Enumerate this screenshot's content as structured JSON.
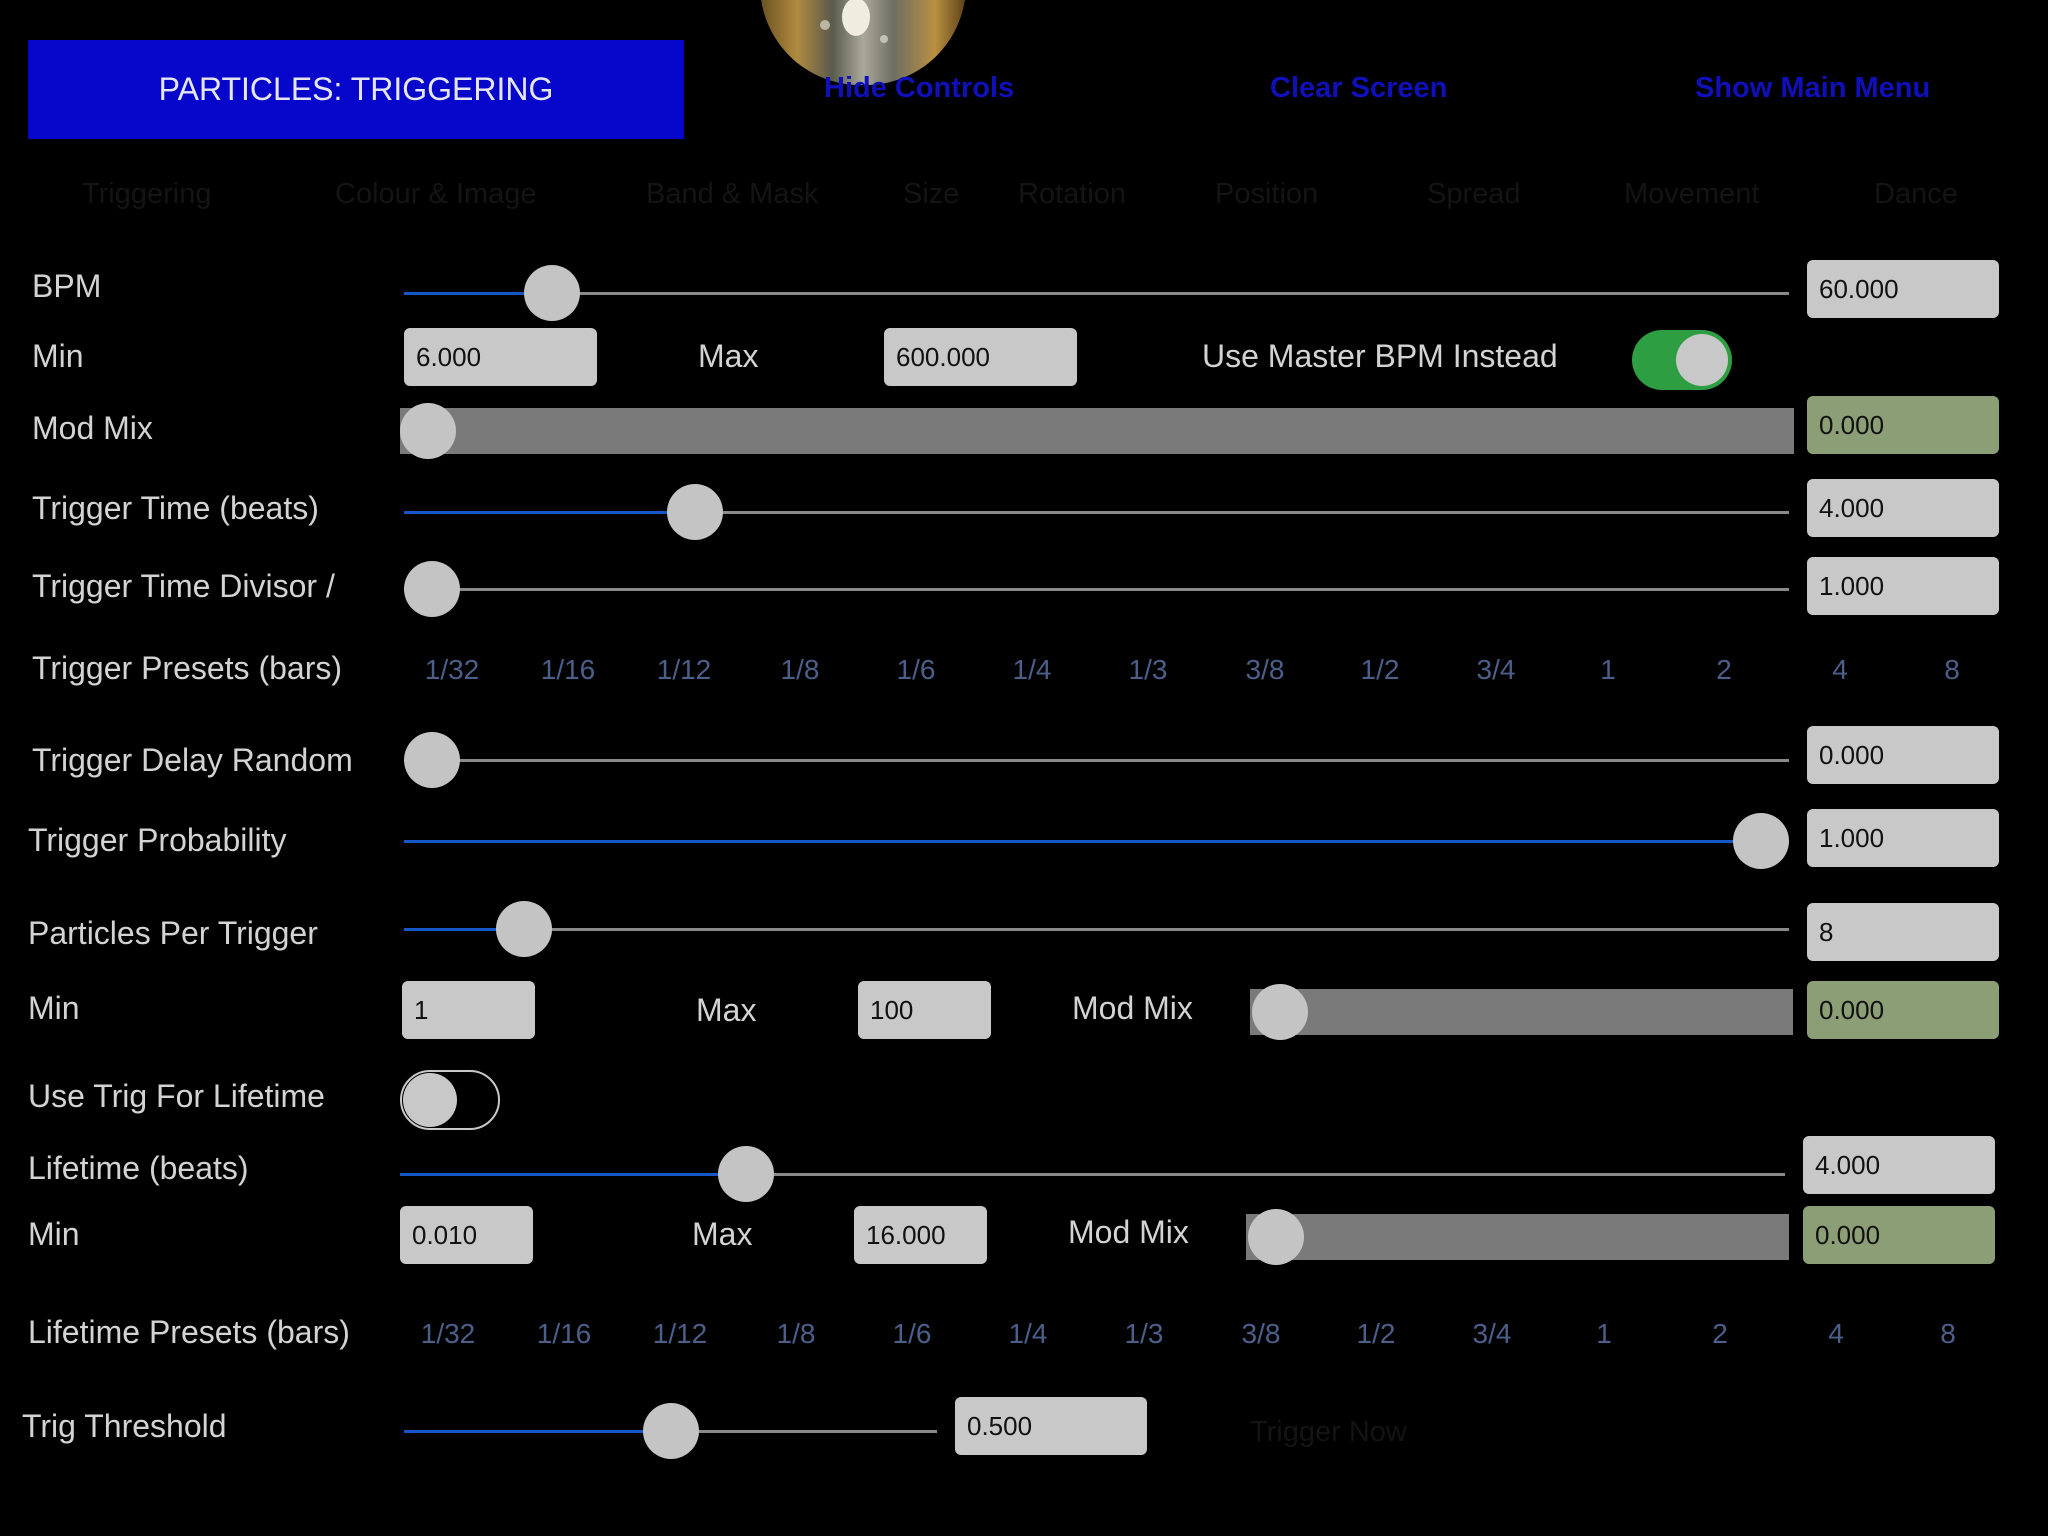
{
  "header": {
    "title": "PARTICLES: TRIGGERING",
    "hide_controls": "Hide Controls",
    "clear_screen": "Clear Screen",
    "show_main_menu": "Show Main Menu"
  },
  "tabs": [
    "Triggering",
    "Colour & Image",
    "Band & Mask",
    "Size",
    "Rotation",
    "Position",
    "Spread",
    "Movement",
    "Dance"
  ],
  "bpm": {
    "label": "BPM",
    "value": "60.000",
    "level": 0.107
  },
  "bpm_range": {
    "min_label": "Min",
    "min": "6.000",
    "max_label": "Max",
    "max": "600.000",
    "master_label": "Use Master BPM Instead",
    "master_on": true
  },
  "bpm_modmix": {
    "label": "Mod Mix",
    "value": "0.000",
    "level": 0.0
  },
  "trigger_time": {
    "label": "Trigger Time (beats)",
    "value": "4.000",
    "level": 0.21
  },
  "trigger_divisor": {
    "label": "Trigger Time Divisor /",
    "value": "1.000",
    "level": 0.0
  },
  "trigger_presets": {
    "label": "Trigger Presets (bars)",
    "items": [
      "1/32",
      "1/16",
      "1/12",
      "1/8",
      "1/6",
      "1/4",
      "1/3",
      "3/8",
      "1/2",
      "3/4",
      "1",
      "2",
      "4",
      "8"
    ]
  },
  "trigger_delay": {
    "label": "Trigger Delay Random",
    "value": "0.000",
    "level": 0.0
  },
  "trigger_probability": {
    "label": "Trigger Probability",
    "value": "1.000",
    "level": 1.0
  },
  "particles_per_trigger": {
    "label": "Particles Per Trigger",
    "value": "8",
    "level": 0.087
  },
  "particles_range": {
    "min_label": "Min",
    "min": "1",
    "max_label": "Max",
    "max": "100",
    "modmix_label": "Mod Mix",
    "modmix_value": "0.000",
    "modmix_level": 0.0
  },
  "use_trig_lifetime": {
    "label": "Use Trig For Lifetime",
    "on": false
  },
  "lifetime": {
    "label": "Lifetime (beats)",
    "value": "4.000",
    "level": 0.25
  },
  "lifetime_range": {
    "min_label": "Min",
    "min": "0.010",
    "max_label": "Max",
    "max": "16.000",
    "modmix_label": "Mod Mix",
    "modmix_value": "0.000",
    "modmix_level": 0.0
  },
  "lifetime_presets": {
    "label": "Lifetime Presets (bars)",
    "items": [
      "1/32",
      "1/16",
      "1/12",
      "1/8",
      "1/6",
      "1/4",
      "1/3",
      "3/8",
      "1/2",
      "3/4",
      "1",
      "2",
      "4",
      "8"
    ]
  },
  "trig_threshold": {
    "label": "Trig Threshold",
    "value": "0.500",
    "level": 0.5
  },
  "trigger_now": "Trigger Now",
  "colors": {
    "accent": "#0707cc",
    "slider_fill": "#1557c8",
    "toggle_on": "#2e9e42",
    "mod_box": "#8c9e76"
  }
}
